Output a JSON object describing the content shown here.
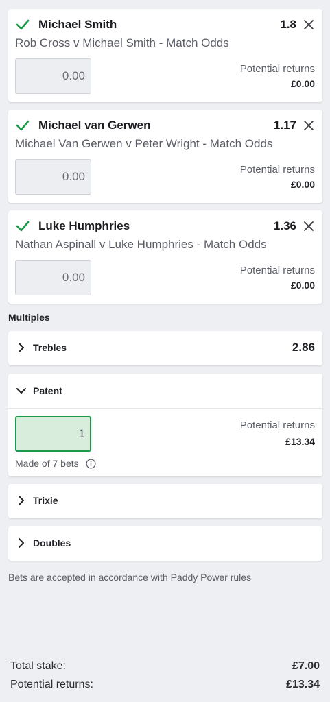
{
  "selections": [
    {
      "name": "Michael Smith",
      "odds": "1.8",
      "market": "Rob Cross v Michael Smith - Match Odds",
      "stake_value": "0.00",
      "returns_label": "Potential returns",
      "returns_value": "£0.00"
    },
    {
      "name": "Michael van Gerwen",
      "odds": "1.17",
      "market": "Michael Van Gerwen v Peter Wright - Match Odds",
      "stake_value": "0.00",
      "returns_label": "Potential returns",
      "returns_value": "£0.00"
    },
    {
      "name": "Luke Humphries",
      "odds": "1.36",
      "market": "Nathan Aspinall v Luke Humphries - Match Odds",
      "stake_value": "0.00",
      "returns_label": "Potential returns",
      "returns_value": "£0.00"
    }
  ],
  "multiples": {
    "section_label": "Multiples",
    "trebles": {
      "label": "Trebles",
      "odds": "2.86"
    },
    "patent": {
      "label": "Patent",
      "stake_value": "1",
      "returns_label": "Potential returns",
      "returns_value": "£13.34",
      "made_of": "Made of 7 bets"
    },
    "trixie": {
      "label": "Trixie"
    },
    "doubles": {
      "label": "Doubles"
    }
  },
  "disclaimer": "Bets are accepted in accordance with Paddy Power rules",
  "footer": {
    "total_stake_label": "Total stake:",
    "total_stake_value": "£7.00",
    "potential_returns_label": "Potential returns:",
    "potential_returns_value": "£13.34"
  },
  "colors": {
    "accent": "#1a9a47",
    "background": "#eeeff2"
  }
}
